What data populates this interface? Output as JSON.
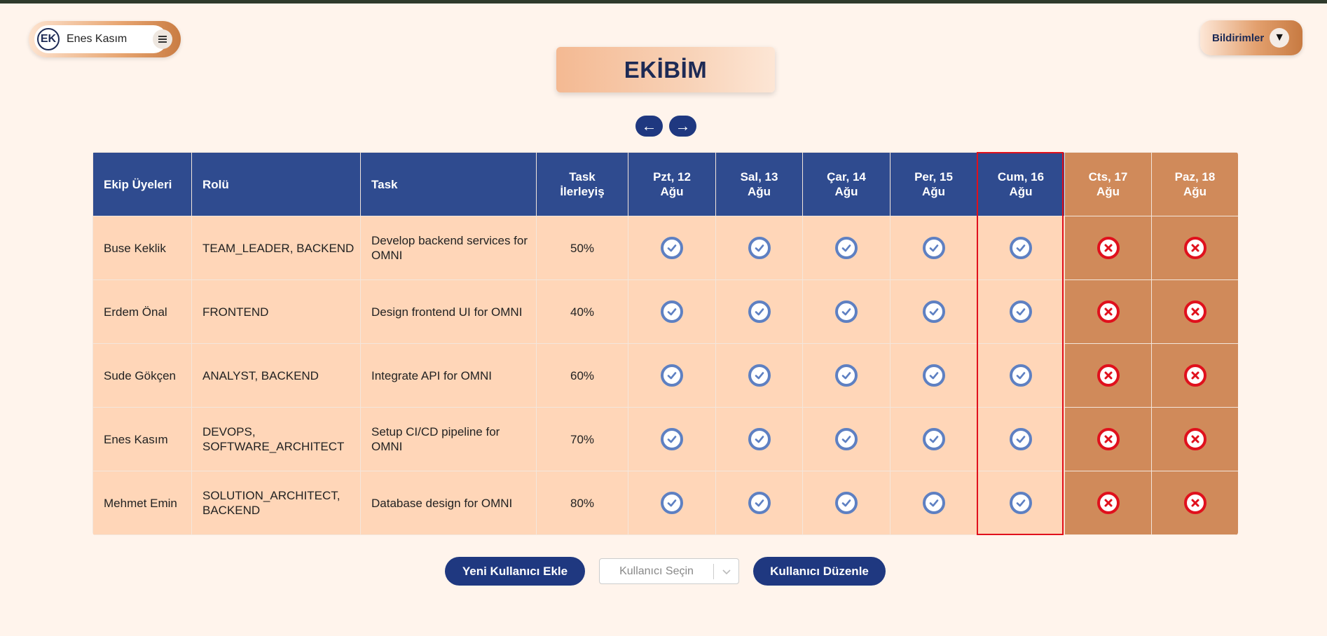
{
  "user": {
    "initials": "EK",
    "name": "Enes Kasım",
    "menu_icon": "hamburger-icon"
  },
  "notifications": {
    "label": "Bildirimler",
    "caret": "▼"
  },
  "page_title": "EKİBİM",
  "nav": {
    "prev": "←",
    "next": "→"
  },
  "table": {
    "headers": {
      "member": "Ekip Üyeleri",
      "role": "Rolü",
      "task": "Task",
      "progress_line1": "Task",
      "progress_line2": "İlerleyiş"
    },
    "days": [
      {
        "line1": "Pzt, 12",
        "line2": "Ağu",
        "weekend": false
      },
      {
        "line1": "Sal, 13",
        "line2": "Ağu",
        "weekend": false
      },
      {
        "line1": "Çar, 14",
        "line2": "Ağu",
        "weekend": false
      },
      {
        "line1": "Per, 15",
        "line2": "Ağu",
        "weekend": false
      },
      {
        "line1": "Cum, 16",
        "line2": "Ağu",
        "weekend": false,
        "highlighted": true
      },
      {
        "line1": "Cts, 17",
        "line2": "Ağu",
        "weekend": true
      },
      {
        "line1": "Paz, 18",
        "line2": "Ağu",
        "weekend": true
      }
    ],
    "rows": [
      {
        "member": "Buse Keklik",
        "role": "TEAM_LEADER, BACKEND",
        "task": "Develop backend services for OMNI",
        "progress": "50%",
        "attendance": [
          "check",
          "check",
          "check",
          "check",
          "check",
          "cross",
          "cross"
        ]
      },
      {
        "member": "Erdem Önal",
        "role": "FRONTEND",
        "task": "Design frontend UI for OMNI",
        "progress": "40%",
        "attendance": [
          "check",
          "check",
          "check",
          "check",
          "check",
          "cross",
          "cross"
        ]
      },
      {
        "member": "Sude Gökçen",
        "role": "ANALYST, BACKEND",
        "task": "Integrate API for OMNI",
        "progress": "60%",
        "attendance": [
          "check",
          "check",
          "check",
          "check",
          "check",
          "cross",
          "cross"
        ]
      },
      {
        "member": "Enes Kasım",
        "role": "DEVOPS, SOFTWARE_ARCHITECT",
        "task": "Setup CI/CD pipeline for OMNI",
        "progress": "70%",
        "attendance": [
          "check",
          "check",
          "check",
          "check",
          "check",
          "cross",
          "cross"
        ]
      },
      {
        "member": "Mehmet Emin",
        "role": "SOLUTION_ARCHITECT, BACKEND",
        "task": "Database design for OMNI",
        "progress": "80%",
        "attendance": [
          "check",
          "check",
          "check",
          "check",
          "check",
          "cross",
          "cross"
        ]
      }
    ]
  },
  "actions": {
    "add_user": "Yeni Kullanıcı Ekle",
    "select_placeholder": "Kullanıcı Seçin",
    "edit_user": "Kullanıcı Düzenle"
  },
  "colors": {
    "header_blue": "#2f4b8f",
    "weekend_header": "#d08a5a",
    "cell": "#ffd6b8",
    "button_blue": "#1f3880",
    "check": "#5e80c2",
    "cross": "#e0101c"
  }
}
